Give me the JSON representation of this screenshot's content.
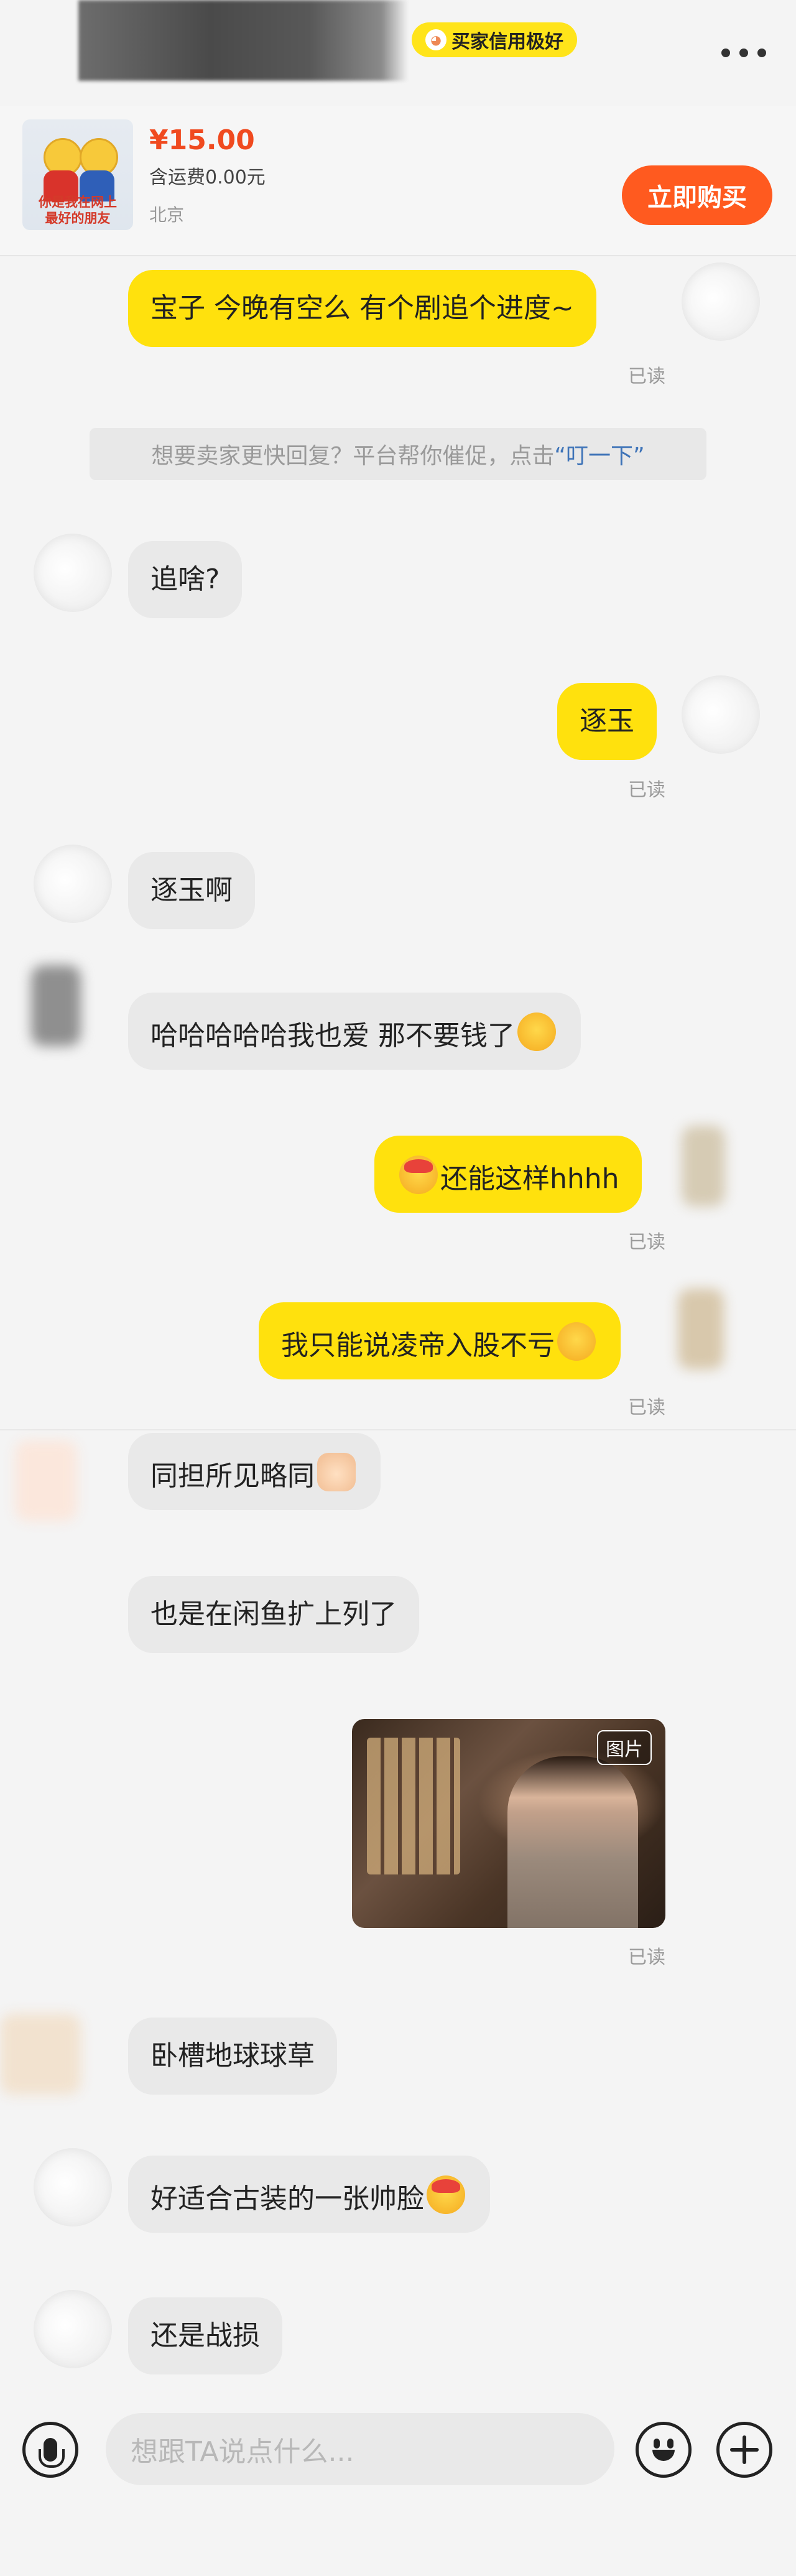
{
  "header": {
    "credit_badge": "买家信用极好"
  },
  "product": {
    "thumb_caption_line1": "你是我在网上",
    "thumb_caption_line2": "最好的朋友",
    "price": "¥15.00",
    "shipping": "含运费0.00元",
    "location": "北京",
    "buy_label": "立即购买"
  },
  "notice": {
    "prefix": "想要卖家更快回复？平台帮你催促，点击",
    "link": "“叮一下”"
  },
  "messages": [
    {
      "from": "me",
      "text": "宝子 今晚有空么 有个剧追个进度~",
      "status": "已读"
    },
    {
      "from": "them",
      "text": "追啥?"
    },
    {
      "from": "me",
      "text": "逐玉",
      "status": "已读"
    },
    {
      "from": "them",
      "text": "逐玉啊"
    },
    {
      "from": "them",
      "text": "哈哈哈哈哈我也爱 那不要钱了"
    },
    {
      "from": "me",
      "text": "还能这样hhhh",
      "status": "已读"
    },
    {
      "from": "me",
      "text": "我只能说凌帝入股不亏",
      "status": "已读"
    },
    {
      "from": "them",
      "text": "同担所见略同"
    },
    {
      "from": "them",
      "text": "也是在闲鱼扩上列了"
    },
    {
      "from": "me",
      "image_tag": "图片",
      "status": "已读"
    },
    {
      "from": "them",
      "text": "卧槽地球球草"
    },
    {
      "from": "them",
      "text": "好适合古装的一张帅脸"
    },
    {
      "from": "them",
      "text": "还是战损"
    }
  ],
  "input": {
    "placeholder": "想跟TA说点什么..."
  },
  "icons": {
    "voice": "microphone-icon",
    "emoji": "smiley-icon",
    "add": "plus-icon",
    "more": "more-dots-icon"
  },
  "colors": {
    "my_bubble": "#ffe10d",
    "their_bubble": "#e9e9e9",
    "buy_button": "#ff5a1f",
    "price": "#f04a1f",
    "link": "#3f74b8"
  }
}
